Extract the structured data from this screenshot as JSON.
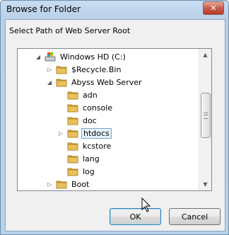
{
  "window": {
    "title": "Browse for Folder",
    "close_glyph": "✕"
  },
  "prompt": "Select Path of Web Server Root",
  "tree": {
    "items": [
      {
        "label": "Windows HD (C:)",
        "icon": "drive-icon",
        "expander": "expanded",
        "depth": 0,
        "selected": false
      },
      {
        "label": "$Recycle.Bin",
        "icon": "folder-icon",
        "expander": "collapsed",
        "depth": 1,
        "selected": false
      },
      {
        "label": "Abyss Web Server",
        "icon": "folder-icon",
        "expander": "expanded",
        "depth": 1,
        "selected": false
      },
      {
        "label": "adn",
        "icon": "folder-icon",
        "expander": "none",
        "depth": 2,
        "selected": false
      },
      {
        "label": "console",
        "icon": "folder-icon",
        "expander": "none",
        "depth": 2,
        "selected": false
      },
      {
        "label": "doc",
        "icon": "folder-icon",
        "expander": "none",
        "depth": 2,
        "selected": false
      },
      {
        "label": "htdocs",
        "icon": "folder-icon",
        "expander": "collapsed",
        "depth": 2,
        "selected": true
      },
      {
        "label": "kcstore",
        "icon": "folder-icon",
        "expander": "none",
        "depth": 2,
        "selected": false
      },
      {
        "label": "lang",
        "icon": "folder-icon",
        "expander": "none",
        "depth": 2,
        "selected": false
      },
      {
        "label": "log",
        "icon": "folder-icon",
        "expander": "none",
        "depth": 2,
        "selected": false
      },
      {
        "label": "Boot",
        "icon": "folder-icon",
        "expander": "collapsed",
        "depth": 1,
        "selected": false
      }
    ]
  },
  "buttons": {
    "ok_label": "OK",
    "cancel_label": "Cancel"
  },
  "colors": {
    "folder": "#e8c15a",
    "selection_border": "#7da2ce",
    "selection_fill": "#e5f3fb"
  }
}
